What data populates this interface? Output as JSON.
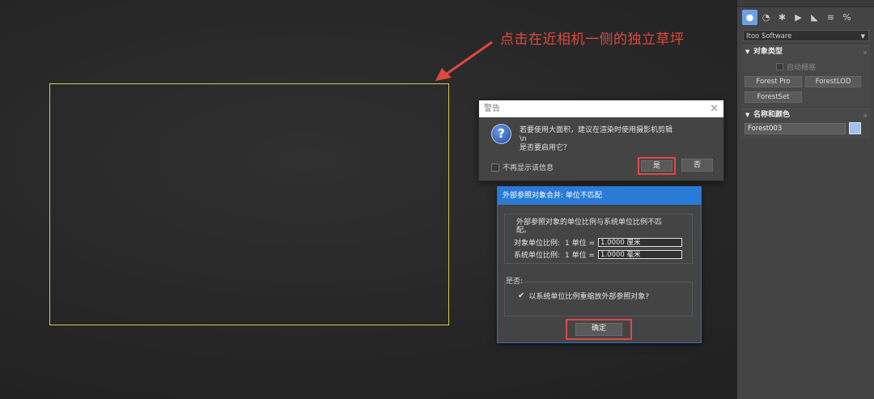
{
  "annotation": {
    "text": "点击在近相机一侧的独立草坪",
    "color": "#e0473d"
  },
  "warning_dialog": {
    "title": "警告",
    "message_line1": "若要使用大面积，建议在渲染时使用摄影机剪辑",
    "message_line2": "\\n",
    "message_line3": "是否要启用它？",
    "checkbox_label": "不再显示该信息",
    "yes_label": "是",
    "no_label": "否",
    "close_glyph": "✕"
  },
  "xref_dialog": {
    "title": "外部参照对象合并: 单位不匹配",
    "description": "外部参照对象的单位比例与系统单位比例不匹配。",
    "object_scale_label": "对象单位比例:",
    "object_scale_unit": "1 单位 =",
    "object_scale_value": "1.0000 厘米",
    "system_scale_label": "系统单位比例:",
    "system_scale_unit": "1 单位 =",
    "system_scale_value": "1.0000 毫米",
    "yesno_label": "是否:",
    "rescale_option": "以系统单位比例重缩放外部参照对象?",
    "rescale_checked": true,
    "ok_label": "确定"
  },
  "command_panel": {
    "tabs": [
      {
        "icon": "geometry-icon",
        "glyph": "●",
        "active": true
      },
      {
        "icon": "shapes-icon",
        "glyph": "◔",
        "active": false
      },
      {
        "icon": "lights-icon",
        "glyph": "✱",
        "active": false
      },
      {
        "icon": "cameras-icon",
        "glyph": "▶",
        "active": false
      },
      {
        "icon": "helpers-icon",
        "glyph": "◣",
        "active": false
      },
      {
        "icon": "spacewarps-icon",
        "glyph": "≋",
        "active": false
      },
      {
        "icon": "systems-icon",
        "glyph": "%",
        "active": false
      }
    ],
    "category_dropdown": "Itoo Software",
    "object_type_header": "对象类型",
    "autogrid_label": "自动栅格",
    "buttons": [
      "Forest Pro",
      "ForestLOD",
      "ForestSet"
    ],
    "name_color_header": "名称和颜色",
    "object_name": "Forest003",
    "object_color": "#9ec2ee"
  }
}
